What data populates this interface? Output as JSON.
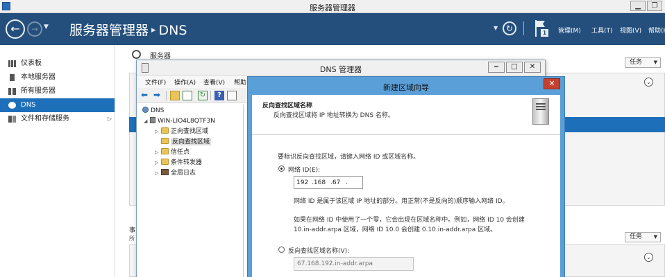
{
  "server_manager": {
    "window_title": "服务器管理器",
    "breadcrumb": {
      "root": "服务器管理器",
      "separator": "▸",
      "current": "DNS"
    },
    "menu": {
      "manage": "管理(M)",
      "tools": "工具(T)",
      "view": "视图(V)",
      "help": "帮助(H)"
    },
    "notification_count": "1",
    "sidebar": {
      "items": [
        {
          "label": "仪表板",
          "icon": "dashboard-icon"
        },
        {
          "label": "本地服务器",
          "icon": "server-icon"
        },
        {
          "label": "所有服务器",
          "icon": "servers-icon"
        },
        {
          "label": "DNS",
          "icon": "dns-icon",
          "active": true
        },
        {
          "label": "文件和存储服务",
          "icon": "storage-icon",
          "has_submenu": true
        }
      ]
    },
    "content": {
      "servers_section_title": "服务器",
      "tasks_label": "任务",
      "bottom_title_fragment": "事",
      "bottom_sub_fragment": "所"
    }
  },
  "dns_manager": {
    "title": "DNS 管理器",
    "menus": [
      "文件(F)",
      "操作(A)",
      "查看(V)",
      "帮助"
    ],
    "tree": {
      "root": "DNS",
      "server": "WIN-LIO4L8QTF3N",
      "children": [
        "正向查找区域",
        "反向查找区域",
        "信任点",
        "条件转发器",
        "全局日志"
      ]
    }
  },
  "wizard": {
    "title": "新建区域向导",
    "close": "✕",
    "header_title": "反向查找区域名称",
    "header_desc": "反向查找区域将 IP 地址转换为 DNS 名称。",
    "prompt": "要标识反向查找区域，请键入网络 ID 或区域名称。",
    "network_id_label": "网络 ID(E):",
    "ip_segments": [
      "192",
      ".168",
      ".67",
      "."
    ],
    "hint1": "网络 ID 是属于该区域 IP 地址的部分。用正常(不是反向的)顺序输入网络 ID。",
    "hint2_line1": "如果在网络 ID 中使用了一个零，它会出现在区域名称中。例如，网络 ID 10 会创建",
    "hint2_line2": "10.in-addr.arpa 区域，网络 ID 10.0 会创建 0.10.in-addr.arpa 区域。",
    "zone_name_label": "反向查找区域名称(V):",
    "zone_name_value": "67.168.192.in-addr.arpa"
  }
}
